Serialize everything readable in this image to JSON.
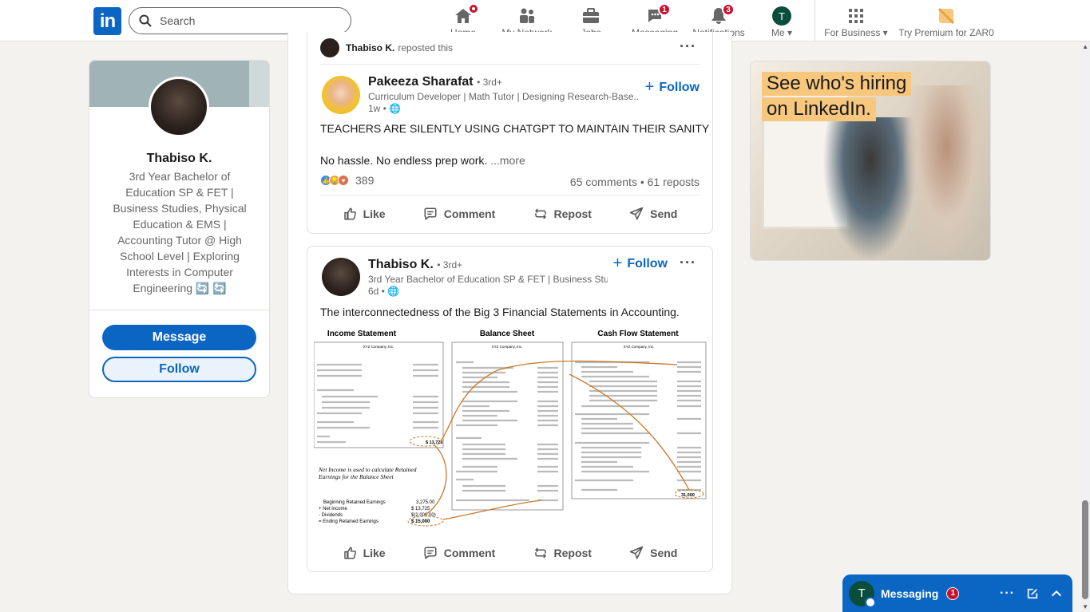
{
  "nav": {
    "search_placeholder": "Search",
    "items": [
      {
        "label": "Home",
        "badge": ""
      },
      {
        "label": "My Network",
        "badge": ""
      },
      {
        "label": "Jobs",
        "badge": ""
      },
      {
        "label": "Messaging",
        "badge": "1"
      },
      {
        "label": "Notifications",
        "badge": "3"
      },
      {
        "label": "Me",
        "badge": ""
      }
    ],
    "me_initial": "T",
    "for_business": "For Business",
    "premium": "Try Premium for ZAR0"
  },
  "profile": {
    "name": "Thabiso K.",
    "headline": "3rd Year Bachelor of Education SP & FET | Business Studies, Physical Education & EMS | Accounting Tutor @ High School Level | Exploring Interests in Computer Engineering 🔄 🔄",
    "message_label": "Message",
    "follow_label": "Follow"
  },
  "post1": {
    "repost_by": "Thabiso K.",
    "repost_text": "reposted this",
    "author": "Pakeeza Sharafat",
    "degree": "• 3rd+",
    "subtitle": "Curriculum Developer | Math Tutor | Designing Research-Base...",
    "time": "1w •",
    "follow": "Follow",
    "text_line1": "TEACHERS ARE SILENTLY USING CHATGPT TO MAINTAIN THEIR SANITY",
    "text_line2": "No hassle. No endless prep work.",
    "more": "...more",
    "reactions_count": "389",
    "stats": "65 comments • 61 reposts",
    "actions": [
      "Like",
      "Comment",
      "Repost",
      "Send"
    ]
  },
  "post2": {
    "author": "Thabiso K.",
    "degree": "• 3rd+",
    "subtitle": "3rd Year Bachelor of Education SP & FET | Business Stu...",
    "time": "6d •",
    "follow": "Follow",
    "text": "The interconnectedness of the Big 3 Financial Statements in Accounting.",
    "figure": {
      "titles": [
        "Income Statement",
        "Balance Sheet",
        "Cash Flow Statement"
      ],
      "company": "XYZ Company, Inc.",
      "note": "Net Income is used to calculate Retained Earnings for the Balance Sheet",
      "retained": [
        {
          "label": "Beginning Retained Earnings",
          "value": "3,275.00"
        },
        {
          "label": "+ Net Income",
          "value": "$ 13,725"
        },
        {
          "label": "- Dividends",
          "value": "$(2,000.00)"
        },
        {
          "label": "= Ending Retained Earnings",
          "value": "$ 15,000"
        }
      ],
      "net_income": "$ 13,725",
      "ending_cash": "31,000"
    },
    "actions": [
      "Like",
      "Comment",
      "Repost",
      "Send"
    ]
  },
  "ad": {
    "line1": "See who's hiring",
    "line2": "on LinkedIn."
  },
  "messaging": {
    "initial": "T",
    "title": "Messaging",
    "badge": "1"
  },
  "colors": {
    "brand": "#0a66c2",
    "badge": "#cb112d"
  }
}
